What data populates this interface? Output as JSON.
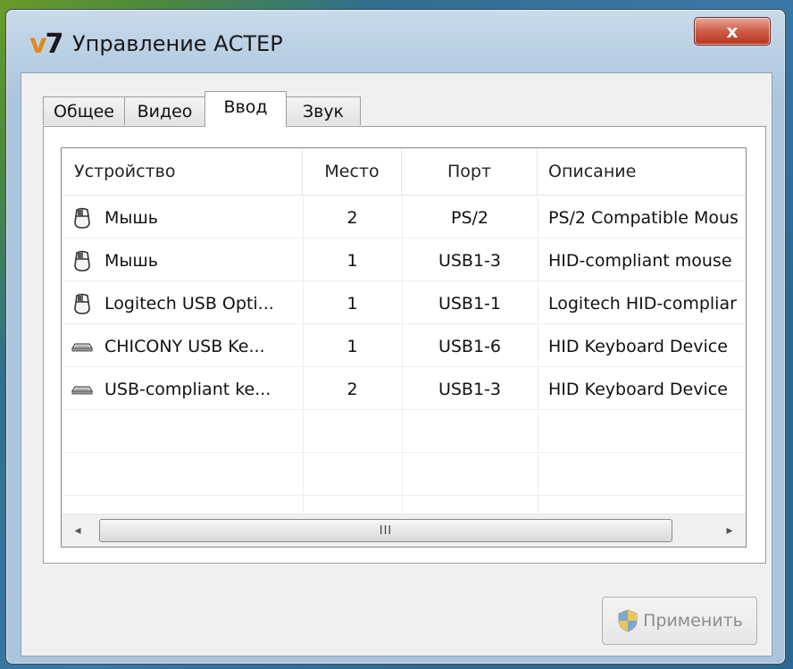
{
  "window": {
    "title": "Управление АСТЕР",
    "logo_text_v": "v",
    "logo_text_n": "7",
    "close_label": "x"
  },
  "tabs": [
    {
      "label": "Общее",
      "active": false
    },
    {
      "label": "Видео",
      "active": false
    },
    {
      "label": "Ввод",
      "active": true
    },
    {
      "label": "Звук",
      "active": false
    }
  ],
  "table": {
    "columns": [
      "Устройство",
      "Место",
      "Порт",
      "Описание"
    ],
    "rows": [
      {
        "icon": "mouse-icon",
        "device": "Мышь",
        "place": "2",
        "port": "PS/2",
        "description": "PS/2 Compatible Mous"
      },
      {
        "icon": "mouse-icon",
        "device": "Мышь",
        "place": "1",
        "port": "USB1-3",
        "description": "HID-compliant mouse"
      },
      {
        "icon": "mouse-icon",
        "device": "Logitech USB Opti...",
        "place": "1",
        "port": "USB1-1",
        "description": "Logitech HID-compliar"
      },
      {
        "icon": "keyboard-icon",
        "device": "CHICONY USB Ke...",
        "place": "1",
        "port": "USB1-6",
        "description": "HID Keyboard Device"
      },
      {
        "icon": "keyboard-icon",
        "device": "USB-compliant ke...",
        "place": "2",
        "port": "USB1-3",
        "description": "HID Keyboard Device"
      }
    ]
  },
  "scrollbar": {
    "left_arrow": "◂",
    "right_arrow": "▸",
    "grip": "III"
  },
  "apply_button": {
    "label": "Применить",
    "enabled": false,
    "icon": "shield-icon"
  },
  "colors": {
    "close_button": "#c8432c",
    "logo_v": "#e08a1a"
  }
}
